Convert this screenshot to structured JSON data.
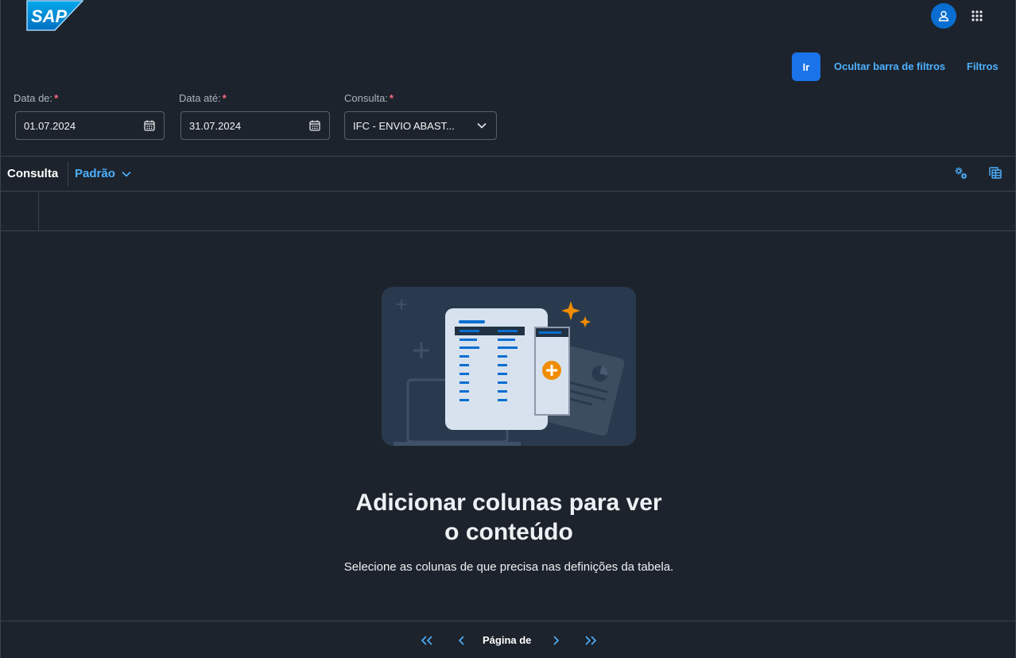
{
  "shell": {
    "logo_text": "SAP",
    "user_icon": "person-icon",
    "menu_icon": "app-grid-icon"
  },
  "filter_bar": {
    "go_label": "Ir",
    "hide_label": "Ocultar barra de filtros",
    "filters_label": "Filtros",
    "fields": [
      {
        "label": "Data de:",
        "required": "*",
        "value": "01.07.2024",
        "icon": "calendar-icon"
      },
      {
        "label": "Data até:",
        "required": "*",
        "value": "31.07.2024",
        "icon": "calendar-icon"
      },
      {
        "label": "Consulta:",
        "required": "*",
        "value": "IFC - ENVIO ABAST...",
        "icon": "chevron-down-icon"
      }
    ]
  },
  "table_toolbar": {
    "title": "Consulta",
    "variant": "Padrão",
    "settings_icon": "table-settings-icon",
    "export_icon": "export-icon"
  },
  "empty_state": {
    "title_line1": "Adicionar colunas para ver",
    "title_line2": "o conteúdo",
    "subtitle": "Selecione as colunas de que precisa nas definições da tabela."
  },
  "pager": {
    "label": "Página de"
  },
  "colors": {
    "background": "#1d232c",
    "accent": "#4db1ff",
    "primary_button": "#1a73e8",
    "required": "#ff6b81"
  }
}
